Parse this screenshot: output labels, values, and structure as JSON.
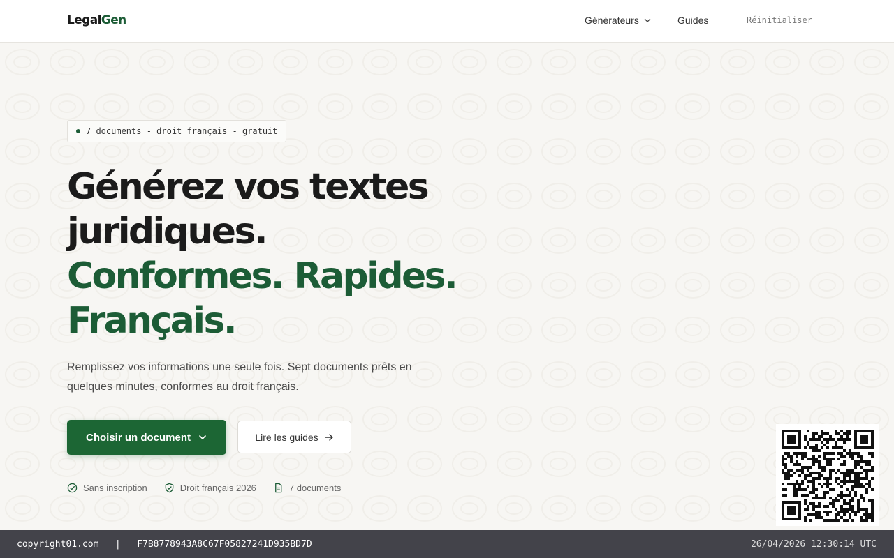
{
  "header": {
    "logo_part1": "Legal",
    "logo_part2": "Gen",
    "nav": {
      "generators_label": "Générateurs",
      "guides_label": "Guides",
      "reset_label": "Réinitialiser"
    }
  },
  "hero": {
    "badge": "7 documents - droit français - gratuit",
    "title_line1": "Générez vos textes",
    "title_line2": "juridiques.",
    "title_line3": "Conformes. Rapides.",
    "title_line4": "Français.",
    "subtitle": "Remplissez vos informations une seule fois. Sept documents prêts en quelques minutes, conformes au droit français.",
    "primary_button": "Choisir un document",
    "secondary_button": "Lire les guides"
  },
  "features": [
    {
      "label": "Sans inscription",
      "icon": "check-circle-icon"
    },
    {
      "label": "Droit français 2026",
      "icon": "shield-check-icon"
    },
    {
      "label": "7 documents",
      "icon": "document-icon"
    }
  ],
  "footer": {
    "site": "copyright01.com",
    "separator": "|",
    "hash": "F7B8778943A8C67F05827241D935BD7D",
    "timestamp": "26/04/2026 12:30:14 UTC"
  },
  "colors": {
    "brand_green": "#1c5c36",
    "button_green": "#1c6634",
    "background": "#f7f6f3",
    "footer_bg": "#43434a"
  }
}
